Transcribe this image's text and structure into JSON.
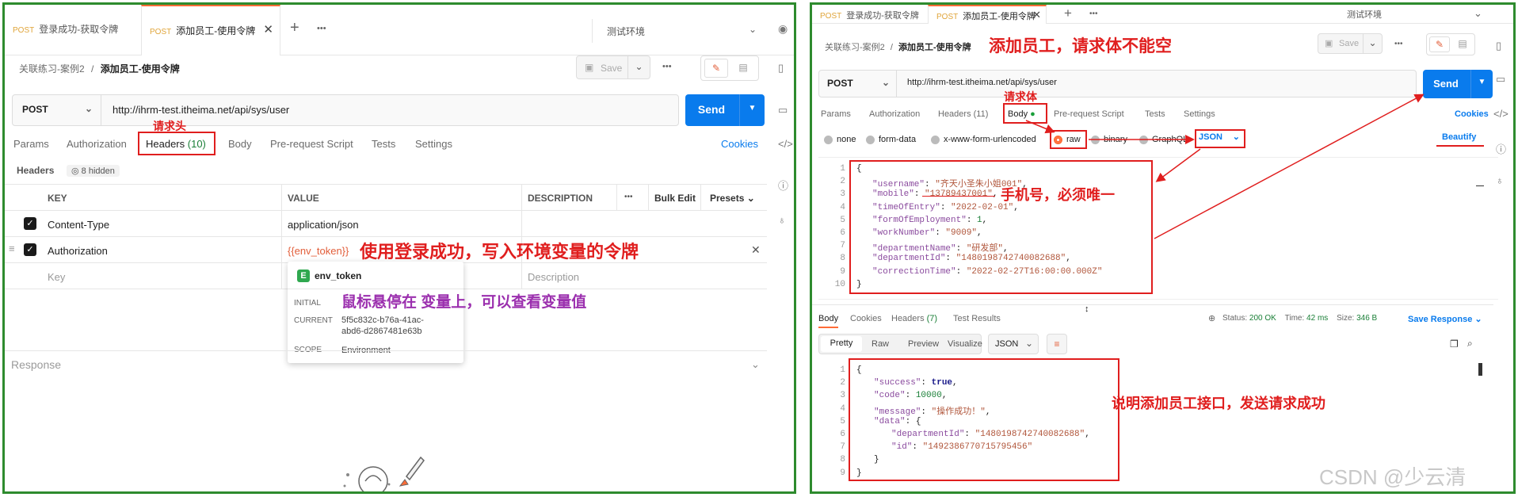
{
  "left": {
    "tabs": [
      {
        "method": "POST",
        "title": "登录成功-获取令牌"
      },
      {
        "method": "POST",
        "title": "添加员工-使用令牌"
      }
    ],
    "new_tab": "+",
    "more": "•••",
    "environment": "测试环境",
    "breadcrumb": {
      "collection": "关联练习-案例2",
      "sep": "/",
      "request": "添加员工-使用令牌"
    },
    "save_label": "Save",
    "method": "POST",
    "url": "http://ihrm-test.itheima.net/api/sys/user",
    "send_label": "Send",
    "subtabs": {
      "params": "Params",
      "authorization": "Authorization",
      "headers": "Headers",
      "headers_count": "(10)",
      "body": "Body",
      "prerequest": "Pre-request Script",
      "tests": "Tests",
      "settings": "Settings",
      "cookies": "Cookies"
    },
    "headers_label": "Headers",
    "hidden_label": "8 hidden",
    "table": {
      "key": "KEY",
      "value": "VALUE",
      "description": "DESCRIPTION",
      "dots": "•••",
      "bulk_edit": "Bulk Edit",
      "presets": "Presets",
      "rows": [
        {
          "key": "Content-Type",
          "value": "application/json"
        },
        {
          "key": "Authorization",
          "value": "{{env_token}}"
        }
      ],
      "placeholder_key": "Key",
      "placeholder_desc": "Description"
    },
    "tooltip": {
      "badge": "E",
      "name": "env_token",
      "initial_label": "INITIAL",
      "initial_value": "",
      "current_label": "CURRENT",
      "current_value_1": "5f5c832c-b76a-41ac-",
      "current_value_2": "abd6-d2867481e63b",
      "scope_label": "SCOPE",
      "scope_value": "Environment"
    },
    "response_label": "Response",
    "annotations": {
      "headers_note": "请求头",
      "token_note": "使用登录成功，写入环境变量的令牌",
      "hover_note": "鼠标悬停在 变量上，可以查看变量值"
    }
  },
  "right": {
    "tabs": [
      {
        "method": "POST",
        "title": "登录成功-获取令牌"
      },
      {
        "method": "POST",
        "title": "添加员工-使用令牌"
      }
    ],
    "environment": "测试环境",
    "breadcrumb": {
      "collection": "关联练习-案例2",
      "sep": "/",
      "request": "添加员工-使用令牌"
    },
    "save_label": "Save",
    "method": "POST",
    "url": "http://ihrm-test.itheima.net/api/sys/user",
    "send_label": "Send",
    "subtabs": {
      "params": "Params",
      "authorization": "Authorization",
      "headers": "Headers",
      "headers_count": "(11)",
      "body": "Body",
      "prerequest": "Pre-request Script",
      "tests": "Tests",
      "settings": "Settings",
      "cookies": "Cookies"
    },
    "body_types": [
      "none",
      "form-data",
      "x-www-form-urlencoded",
      "raw",
      "binary",
      "GraphQL"
    ],
    "format": "JSON",
    "beautify": "Beautify",
    "request_body": [
      {
        "ln": "1",
        "text": "{"
      },
      {
        "ln": "2",
        "key": "\"username\"",
        "val": "\"齐天小圣朱小姐001\"",
        "type": "s"
      },
      {
        "ln": "3",
        "key": "\"mobile\"",
        "val": "\"13789437001\"",
        "type": "s"
      },
      {
        "ln": "4",
        "key": "\"timeOfEntry\"",
        "val": "\"2022-02-01\"",
        "type": "s"
      },
      {
        "ln": "5",
        "key": "\"formOfEmployment\"",
        "val": "1",
        "type": "n"
      },
      {
        "ln": "6",
        "key": "\"workNumber\"",
        "val": "\"9009\"",
        "type": "s"
      },
      {
        "ln": "7",
        "key": "\"departmentName\"",
        "val": "\"研发部\"",
        "type": "s"
      },
      {
        "ln": "8",
        "key": "\"departmentId\"",
        "val": "\"1480198742740082688\"",
        "type": "s"
      },
      {
        "ln": "9",
        "key": "\"correctionTime\"",
        "val": "\"2022-02-27T16:00:00.000Z\"",
        "type": "s",
        "last": true
      },
      {
        "ln": "10",
        "text": "}"
      }
    ],
    "response_tabs": {
      "body": "Body",
      "cookies": "Cookies",
      "headers": "Headers",
      "headers_count": "(7)",
      "test_results": "Test Results"
    },
    "status": {
      "label": "Status:",
      "value": "200 OK",
      "time_label": "Time:",
      "time": "42 ms",
      "size_label": "Size:",
      "size": "346 B"
    },
    "save_response": "Save Response",
    "view_modes": [
      "Pretty",
      "Raw",
      "Preview",
      "Visualize"
    ],
    "response_format": "JSON",
    "response_body": [
      {
        "ln": "1",
        "text": "{"
      },
      {
        "ln": "2",
        "indent": 1,
        "key": "\"success\"",
        "val": "true",
        "type": "b"
      },
      {
        "ln": "3",
        "indent": 1,
        "key": "\"code\"",
        "val": "10000",
        "type": "n"
      },
      {
        "ln": "4",
        "indent": 1,
        "key": "\"message\"",
        "val": "\"操作成功！\"",
        "type": "s"
      },
      {
        "ln": "5",
        "indent": 1,
        "key": "\"data\"",
        "val": "{",
        "type": "p"
      },
      {
        "ln": "6",
        "indent": 2,
        "key": "\"departmentId\"",
        "val": "\"1480198742740082688\"",
        "type": "s"
      },
      {
        "ln": "7",
        "indent": 2,
        "key": "\"id\"",
        "val": "\"1492386770715795456\"",
        "type": "s",
        "last": true
      },
      {
        "ln": "8",
        "indent": 1,
        "text": "}"
      },
      {
        "ln": "9",
        "text": "}"
      }
    ],
    "annotations": {
      "title_note": "添加员工，请求体不能空",
      "body_note": "请求体",
      "mobile_note": "手机号，必须唯一",
      "success_note": "说明添加员工接口，发送请求成功"
    }
  },
  "watermark": "CSDN @少云清",
  "colors": {
    "accent": "#ff6c37",
    "send": "#097bed",
    "annotation": "#e01e1e",
    "note_purple": "#9b2fae",
    "panel_border": "#2e8b2e"
  }
}
